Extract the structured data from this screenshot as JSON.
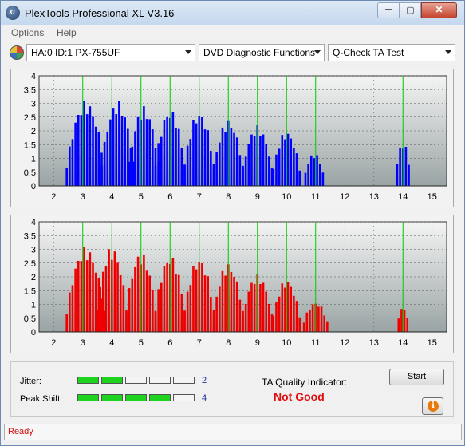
{
  "window": {
    "title": "PlexTools Professional XL V3.16",
    "app_icon_text": "XL"
  },
  "window_controls": {
    "minimize": "─",
    "maximize": "▢",
    "close": "✕"
  },
  "menu": [
    {
      "label": "Options"
    },
    {
      "label": "Help"
    }
  ],
  "toolbar": {
    "drive": "HA:0 ID:1  PX-755UF",
    "function": "DVD Diagnostic Functions",
    "test": "Q-Check TA Test"
  },
  "colors": {
    "top_bars": "#0000ff",
    "bottom_bars": "#ee0000",
    "marker_lines": "#00cc00",
    "plot_bg_top": "#f4f4f4",
    "plot_bg_bottom": "#9aa4a4"
  },
  "chart_data": [
    {
      "type": "bar",
      "xlim": [
        1.5,
        15.5
      ],
      "ylim": [
        0,
        4
      ],
      "x_ticks": [
        "2",
        "3",
        "4",
        "5",
        "6",
        "7",
        "8",
        "9",
        "10",
        "11",
        "12",
        "13",
        "14",
        "15"
      ],
      "y_ticks": [
        "0",
        "0,5",
        "1",
        "1,5",
        "2",
        "2,5",
        "3",
        "3,5",
        "4"
      ],
      "grid": true,
      "markers": [
        3,
        4,
        5,
        6,
        7,
        8,
        9,
        10,
        11,
        14
      ],
      "peaks": [
        {
          "center": 3.1,
          "height": 3.1,
          "halfwidth": 0.75
        },
        {
          "center": 4.2,
          "height": 3.1,
          "halfwidth": 0.65
        },
        {
          "center": 5.1,
          "height": 2.9,
          "halfwidth": 0.6
        },
        {
          "center": 6.0,
          "height": 2.8,
          "halfwidth": 0.6
        },
        {
          "center": 7.0,
          "height": 2.7,
          "halfwidth": 0.6
        },
        {
          "center": 8.0,
          "height": 2.4,
          "halfwidth": 0.6
        },
        {
          "center": 9.0,
          "height": 2.2,
          "halfwidth": 0.6
        },
        {
          "center": 10.0,
          "height": 2.0,
          "halfwidth": 0.55
        },
        {
          "center": 10.95,
          "height": 1.2,
          "halfwidth": 0.4
        },
        {
          "center": 14.0,
          "height": 1.6,
          "halfwidth": 0.3
        }
      ]
    },
    {
      "type": "bar",
      "xlim": [
        1.5,
        15.5
      ],
      "ylim": [
        0,
        4
      ],
      "x_ticks": [
        "2",
        "3",
        "4",
        "5",
        "6",
        "7",
        "8",
        "9",
        "10",
        "11",
        "12",
        "13",
        "14",
        "15"
      ],
      "y_ticks": [
        "0",
        "0,5",
        "1",
        "1,5",
        "2",
        "2,5",
        "3",
        "3,5",
        "4"
      ],
      "grid": true,
      "markers": [
        3,
        4,
        5,
        6,
        7,
        8,
        9,
        10,
        11,
        14
      ],
      "peaks": [
        {
          "center": 3.1,
          "height": 3.1,
          "halfwidth": 0.75
        },
        {
          "center": 4.0,
          "height": 3.1,
          "halfwidth": 0.6
        },
        {
          "center": 5.0,
          "height": 2.9,
          "halfwidth": 0.6
        },
        {
          "center": 6.0,
          "height": 2.8,
          "halfwidth": 0.6
        },
        {
          "center": 7.0,
          "height": 2.7,
          "halfwidth": 0.6
        },
        {
          "center": 8.0,
          "height": 2.5,
          "halfwidth": 0.6
        },
        {
          "center": 9.0,
          "height": 2.1,
          "halfwidth": 0.6
        },
        {
          "center": 10.0,
          "height": 1.9,
          "halfwidth": 0.55
        },
        {
          "center": 11.0,
          "height": 1.1,
          "halfwidth": 0.5
        },
        {
          "center": 14.0,
          "height": 0.9,
          "halfwidth": 0.25
        }
      ]
    }
  ],
  "quality": {
    "jitter_label": "Jitter:",
    "jitter_value": "2",
    "jitter_level": 2,
    "peak_shift_label": "Peak Shift:",
    "peak_shift_value": "4",
    "peak_shift_level": 4,
    "segments": 5,
    "ta_label": "TA Quality Indicator:",
    "ta_value": "Not Good"
  },
  "buttons": {
    "start": "Start",
    "info_icon": "i"
  },
  "status": {
    "text": "Ready"
  }
}
